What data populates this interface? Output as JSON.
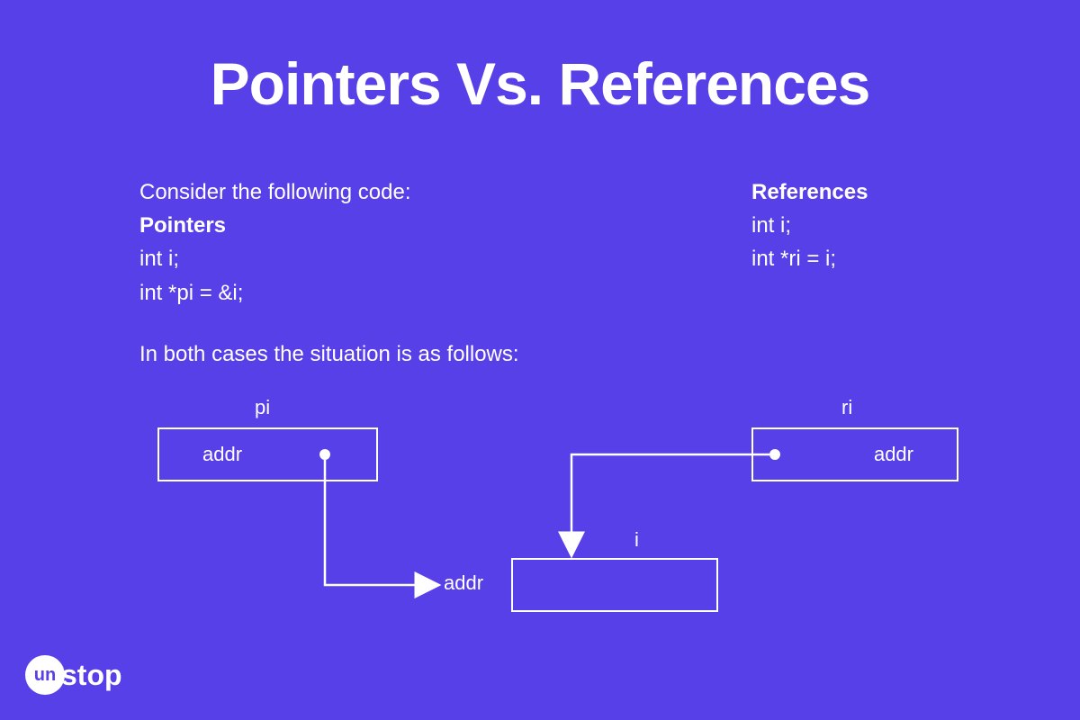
{
  "title": "Pointers Vs. References",
  "pointers": {
    "intro": "Consider the following code:",
    "label": "Pointers",
    "line1": "int i;",
    "line2": "int *pi = &i;"
  },
  "references": {
    "label": "References",
    "line1": "int i;",
    "line2": "int *ri = i;"
  },
  "bridge": "In both cases the situation is as follows:",
  "diagram": {
    "pi_label": "pi",
    "pi_content": "addr",
    "i_label": "i",
    "i_addr": "addr",
    "ri_label": "ri",
    "ri_content": "addr"
  },
  "brand": {
    "circle": "un",
    "rest": "stop"
  }
}
